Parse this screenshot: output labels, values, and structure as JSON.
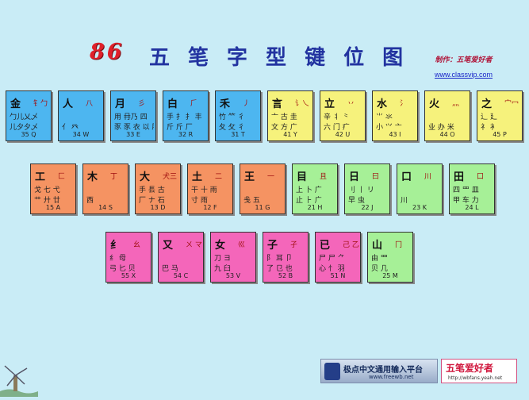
{
  "title": {
    "number": "86",
    "chars": [
      "五",
      "笔",
      "字",
      "型",
      "键",
      "位",
      "图"
    ]
  },
  "credit": "制作：五笔爱好者",
  "site": "www.classvip.com",
  "colors": {
    "blue": "#4db6f0",
    "yellow": "#f6f27c",
    "orange": "#f59362",
    "green": "#a6f097",
    "pink": "#f466ba"
  },
  "keys": [
    {
      "main": "金",
      "aux": "钅勹",
      "r1": "勹儿乂乄",
      "r2": "儿夕夕乄",
      "code": "35 Q"
    },
    {
      "main": "人",
      "aux": "八",
      "r1": "",
      "r2": "亻 癶",
      "code": "34 W"
    },
    {
      "main": "月",
      "aux": "彡",
      "r1": "用 冄乃 四",
      "r2": "豕 豕 衣 以 ⺼",
      "code": "33 E"
    },
    {
      "main": "白",
      "aux": "⺁",
      "r1": "手 扌 ⺘ 丰",
      "r2": "斤 斤 厂",
      "code": "32 R"
    },
    {
      "main": "禾",
      "aux": "丿",
      "r1": "竹 ⺮ 彳",
      "r2": "夂 攵 彳",
      "code": "31 T"
    },
    {
      "main": "言",
      "aux": "讠乀",
      "r1": "亠 古 圭",
      "r2": "文 方 广",
      "code": "41 Y"
    },
    {
      "main": "立",
      "aux": "丷",
      "r1": "辛 丬 ⺀",
      "r2": "六 门 疒",
      "code": "42 U"
    },
    {
      "main": "水",
      "aux": "氵",
      "r1": "⺌ 氺",
      "r2": "小 ⺍ 亠",
      "code": "43 I"
    },
    {
      "main": "火",
      "aux": "灬",
      "r1": "",
      "r2": "业 办 米",
      "code": "44 O"
    },
    {
      "main": "之",
      "aux": "宀冖",
      "r1": "辶 廴",
      "r2": "礻 衤",
      "code": "45 P"
    },
    {
      "main": "工",
      "aux": "匚",
      "r1": "戈 七 弋",
      "r2": "艹 廾 廿",
      "code": "15 A"
    },
    {
      "main": "木",
      "aux": "丁",
      "r1": "",
      "r2": "西",
      "code": "14 S"
    },
    {
      "main": "大",
      "aux": "犬三",
      "r1": "手 镸 古",
      "r2": "厂 ナ 石",
      "code": "13 D"
    },
    {
      "main": "土",
      "aux": "二",
      "r1": "干 十 雨",
      "r2": "寸 雨",
      "code": "12 F"
    },
    {
      "main": "王",
      "aux": "一",
      "r1": "",
      "r2": "戋 五",
      "code": "11 G"
    },
    {
      "main": "目",
      "aux": "且",
      "r1": "上 卜 广",
      "r2": "止 ⺊ 广",
      "code": "21 H"
    },
    {
      "main": "日",
      "aux": "曰",
      "r1": "刂 丨 リ",
      "r2": "早 虫",
      "code": "22 J"
    },
    {
      "main": "口",
      "aux": "川",
      "r1": "",
      "r2": "川",
      "code": "23 K"
    },
    {
      "main": "田",
      "aux": "口",
      "r1": "四 罒 皿",
      "r2": "甲 车 力",
      "code": "24 L"
    },
    {
      "main": "纟",
      "aux": "幺",
      "r1": "纟 母",
      "r2": "弓 匕 贝",
      "code": "55 X"
    },
    {
      "main": "又",
      "aux": "ㄨ マ",
      "r1": "",
      "r2": "巴 马",
      "code": "54 C"
    },
    {
      "main": "女",
      "aux": "巛",
      "r1": "刀 ヨ",
      "r2": "九 臼",
      "code": "53 V"
    },
    {
      "main": "子",
      "aux": "孑",
      "r1": "阝 耳 卩",
      "r2": "了 ⺋ 也",
      "code": "52 B"
    },
    {
      "main": "已",
      "aux": "己 乙",
      "r1": "尸 尸 ⺈",
      "r2": "心 忄 羽",
      "code": "51 N"
    },
    {
      "main": "山",
      "aux": "冂",
      "r1": "由 罒",
      "r2": "贝 几",
      "code": "25 M"
    }
  ],
  "banner1": {
    "text": "极点中文通用输入平台",
    "url": "www.freewb.net"
  },
  "banner2": {
    "text": "五笔爱好者",
    "url": "http://wbfans.yeah.net"
  }
}
